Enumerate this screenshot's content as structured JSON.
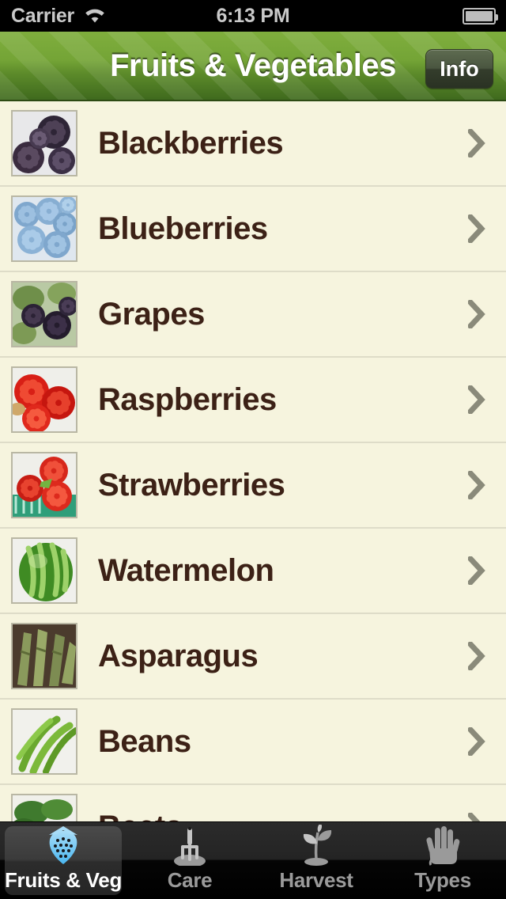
{
  "statusbar": {
    "carrier": "Carrier",
    "time": "6:13 PM",
    "wifi_icon": "wifi-icon",
    "battery_icon": "battery-icon"
  },
  "navbar": {
    "title": "Fruits & Vegetables",
    "info_label": "Info",
    "accent_green": "#74a436",
    "title_color": "#ffffff"
  },
  "list": {
    "background": "#F6F4DE",
    "text_color": "#3C2116",
    "separator_color": "#dedcc8",
    "chevron_color": "#8a8a7a",
    "items": [
      {
        "label": "Blackberries",
        "thumb": "blackberries-photo"
      },
      {
        "label": "Blueberries",
        "thumb": "blueberries-photo"
      },
      {
        "label": "Grapes",
        "thumb": "grapes-photo"
      },
      {
        "label": "Raspberries",
        "thumb": "raspberries-photo"
      },
      {
        "label": "Strawberries",
        "thumb": "strawberries-photo"
      },
      {
        "label": "Watermelon",
        "thumb": "watermelon-photo"
      },
      {
        "label": "Asparagus",
        "thumb": "asparagus-photo"
      },
      {
        "label": "Beans",
        "thumb": "beans-photo"
      },
      {
        "label": "Beets",
        "thumb": "beets-photo"
      }
    ]
  },
  "tabbar": {
    "tabs": [
      {
        "label": "Fruits & Veg",
        "icon": "strawberry-icon",
        "selected": true
      },
      {
        "label": "Care",
        "icon": "garden-fork-icon",
        "selected": false
      },
      {
        "label": "Harvest",
        "icon": "seedling-icon",
        "selected": false
      },
      {
        "label": "Types",
        "icon": "glove-icon",
        "selected": false
      }
    ],
    "selected_color": "#4bb7f0",
    "inactive_color": "#9a9a9a"
  }
}
